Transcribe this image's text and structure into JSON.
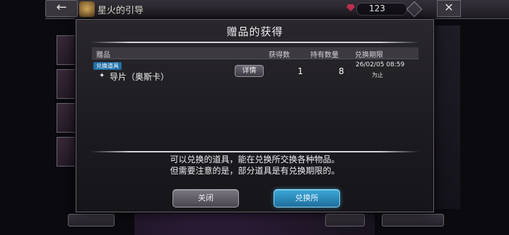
{
  "header": {
    "title": "星火的引导",
    "currency": "123",
    "back_icon": "←",
    "close_icon": "✕"
  },
  "modal": {
    "title": "赠品的获得",
    "columns": {
      "item": "赠品",
      "got": "获得数",
      "held": "持有数量",
      "deadline": "兑换期限"
    },
    "items": [
      {
        "badge": "兑换道具",
        "name": "导片（奥斯卡）",
        "detail_label": "详情",
        "got": "1",
        "held": "8",
        "deadline": "26/02/05 08:59",
        "deadline_suffix": "为止"
      }
    ],
    "message_line1": "可以兑换的道具，能在兑换所交换各种物品。",
    "message_line2": "但需要注意的是，部分道具是有兑换期限的。",
    "close_button": "关闭",
    "exchange_button": "兑换所"
  },
  "colors": {
    "accent_blue": "#2a8cc4",
    "badge_blue": "#1f6fa8",
    "gem_red": "#c03050"
  }
}
